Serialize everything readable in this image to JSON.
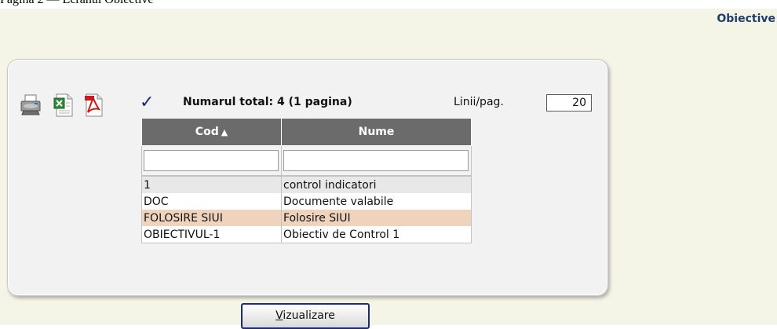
{
  "header": {
    "caption": "Pagina 2 — Ecranul Obiective",
    "title": "Obiective"
  },
  "toolbar": {
    "icons": [
      "printer-icon",
      "excel-icon",
      "pdf-icon",
      "check-icon"
    ],
    "total_text": "Numarul total: 4 (1 pagina)",
    "rows_per_page_label": "Linii/pag.",
    "rows_per_page_value": "20"
  },
  "table": {
    "columns": [
      {
        "label": "Cod",
        "sort": "ascending"
      },
      {
        "label": "Nume"
      }
    ],
    "filters": [
      "",
      ""
    ],
    "rows": [
      {
        "cod": "1",
        "nume": "control indicatori"
      },
      {
        "cod": "DOC",
        "nume": "Documente valabile"
      },
      {
        "cod": "FOLOSIRE SIUI",
        "nume": "Folosire SIUI"
      },
      {
        "cod": "OBIECTIVUL-1",
        "nume": "Obiectiv de Control 1"
      }
    ],
    "selected_row_index": 2
  },
  "actions": {
    "view_button_label_first": "V",
    "view_button_label_rest": "izualizare"
  },
  "colors": {
    "background": "#f5f5e7",
    "header_bg": "#6b6b6b",
    "selected_row": "#efd3bd",
    "title": "#1e3d6b",
    "button_border": "#1b2a7a"
  }
}
